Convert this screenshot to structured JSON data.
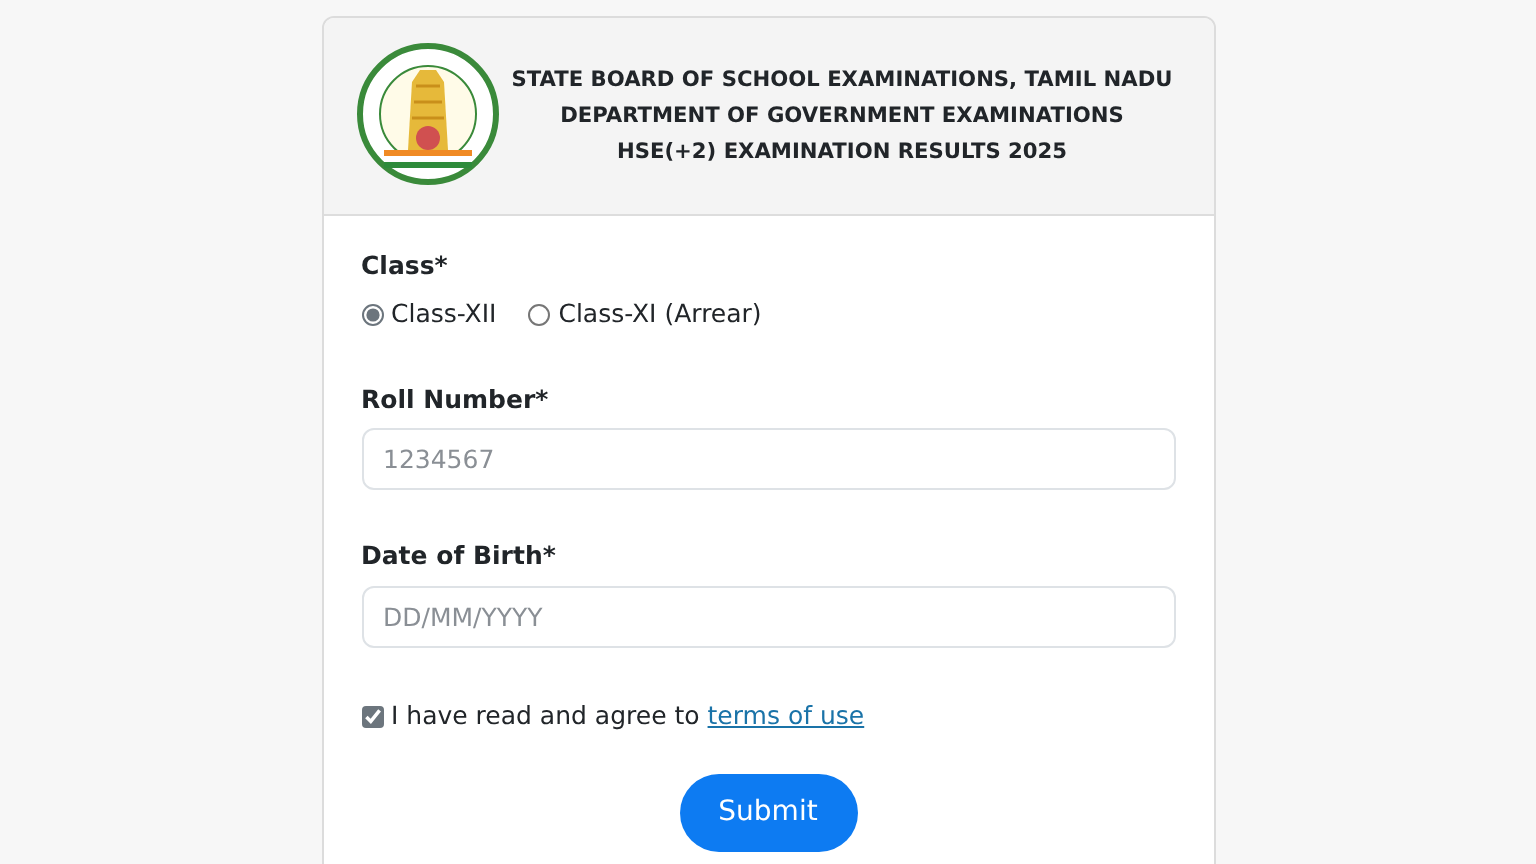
{
  "header": {
    "lines": [
      "STATE BOARD OF SCHOOL EXAMINATIONS, TAMIL NADU",
      "DEPARTMENT OF GOVERNMENT EXAMINATIONS",
      "HSE(+2) EXAMINATION RESULTS 2025"
    ]
  },
  "class_field": {
    "label": "Class*",
    "options": [
      {
        "label": "Class-XII",
        "selected": true
      },
      {
        "label": "Class-XI (Arrear)",
        "selected": false
      }
    ]
  },
  "roll_number": {
    "label": "Roll Number*",
    "placeholder": "1234567"
  },
  "date_of_birth": {
    "label": "Date of Birth*",
    "placeholder": "DD/MM/YYYY"
  },
  "agreement": {
    "text": "I have read and agree to",
    "link": "terms of use",
    "checked": true
  },
  "submit": {
    "label": "Submit"
  }
}
